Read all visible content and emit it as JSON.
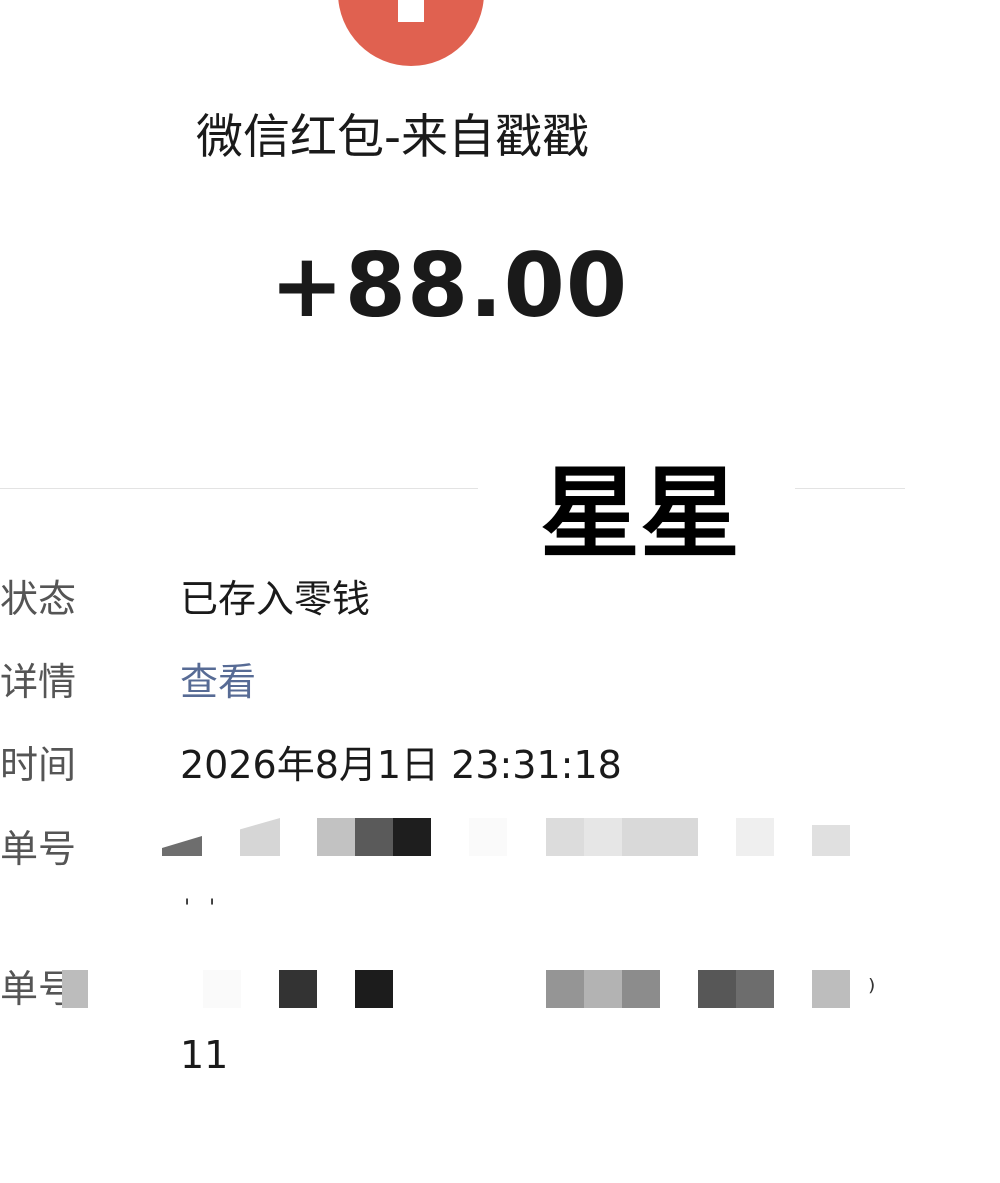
{
  "header": {
    "title": "微信红包-来自戳戳",
    "amount": "+88.00",
    "accent_color": "#e06150"
  },
  "overlay": {
    "text": "星星"
  },
  "details": {
    "status_label": "状态",
    "status_value": "已存入零钱",
    "details_label": "详情",
    "details_link": "查看",
    "time_label": "时间",
    "time_value": "2026年8月1日 23:31:18",
    "order_label": "单号",
    "order_tail": "11",
    "order2_label": "单号"
  },
  "colors": {
    "link": "#576b95",
    "label": "#555555",
    "text": "#1a1a1a"
  }
}
